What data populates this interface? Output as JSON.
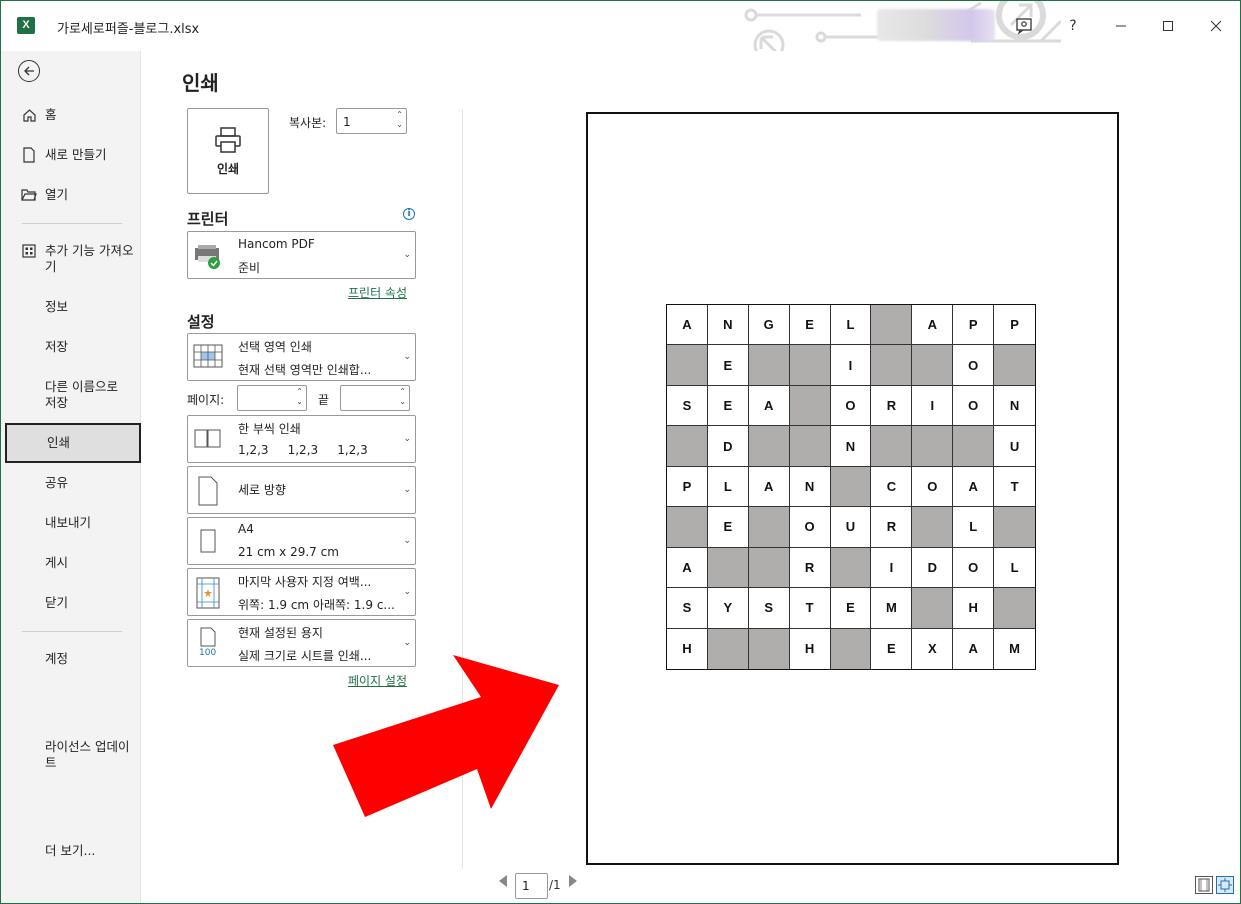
{
  "window": {
    "title": "가로세로퍼즐-블로그.xlsx",
    "app_icon_letter": "X",
    "help_label": "?"
  },
  "nav": {
    "items": [
      {
        "label": "홈",
        "icon": "home-icon"
      },
      {
        "label": "새로 만들기",
        "icon": "new-file-icon"
      },
      {
        "label": "열기",
        "icon": "folder-open-icon"
      },
      {
        "label": "추가 기능 가져오기",
        "icon": "addins-grid-icon"
      },
      {
        "label": "정보"
      },
      {
        "label": "저장"
      },
      {
        "label": "다른 이름으로 저장"
      },
      {
        "label": "인쇄"
      },
      {
        "label": "공유"
      },
      {
        "label": "내보내기"
      },
      {
        "label": "게시"
      },
      {
        "label": "닫기"
      },
      {
        "label": "계정"
      },
      {
        "label": "라이선스 업데이트"
      },
      {
        "label": "더 보기..."
      }
    ]
  },
  "print": {
    "title": "인쇄",
    "print_button_label": "인쇄",
    "copies_label": "복사본:",
    "copies_value": "1",
    "printer_section": "프린터",
    "printer_name": "Hancom PDF",
    "printer_status": "준비",
    "printer_properties_link": "프린터 속성",
    "settings_section": "설정",
    "setting_scope_title": "선택 영역 인쇄",
    "setting_scope_desc": "현재 선택 영역만 인쇄합...",
    "pages_label": "페이지:",
    "pages_to_label": "끝",
    "pages_from_value": "",
    "pages_to_value": "",
    "collate_title": "한 부씩 인쇄",
    "collate_desc": "1,2,3     1,2,3     1,2,3",
    "orientation_title": "세로 방향",
    "paper_title": "A4",
    "paper_desc": "21 cm x 29.7 cm",
    "margins_title": "마지막 사용자 지정 여백...",
    "margins_desc": "위쪽: 1.9 cm 아래쪽: 1.9 c...",
    "scaling_title": "현재 설정된 용지",
    "scaling_desc": "실제 크기로 시트를 인쇄...",
    "scaling_icon_text": "100",
    "page_setup_link": "페이지 설정"
  },
  "preview": {
    "grid": [
      [
        "A",
        "N",
        "G",
        "E",
        "L",
        "#",
        "A",
        "P",
        "P"
      ],
      [
        "#",
        "E",
        "#",
        "#",
        "I",
        "#",
        "#",
        "O",
        "#"
      ],
      [
        "S",
        "E",
        "A",
        "#",
        "O",
        "R",
        "I",
        "O",
        "N"
      ],
      [
        "#",
        "D",
        "#",
        "#",
        "N",
        "#",
        "#",
        "#",
        "U"
      ],
      [
        "P",
        "L",
        "A",
        "N",
        "#",
        "C",
        "O",
        "A",
        "T"
      ],
      [
        "#",
        "E",
        "#",
        "O",
        "U",
        "R",
        "#",
        "L",
        "#"
      ],
      [
        "A",
        "#",
        "#",
        "R",
        "#",
        "I",
        "D",
        "O",
        "L"
      ],
      [
        "S",
        "Y",
        "S",
        "T",
        "E",
        "M",
        "#",
        "H",
        "#"
      ],
      [
        "H",
        "#",
        "#",
        "H",
        "#",
        "E",
        "X",
        "A",
        "M"
      ]
    ],
    "blocked_cell_color": "#b0adad",
    "current_page": "1",
    "total_pages": "/1"
  },
  "colors": {
    "accent": "#1e7145",
    "arrow": "#ff0000"
  }
}
